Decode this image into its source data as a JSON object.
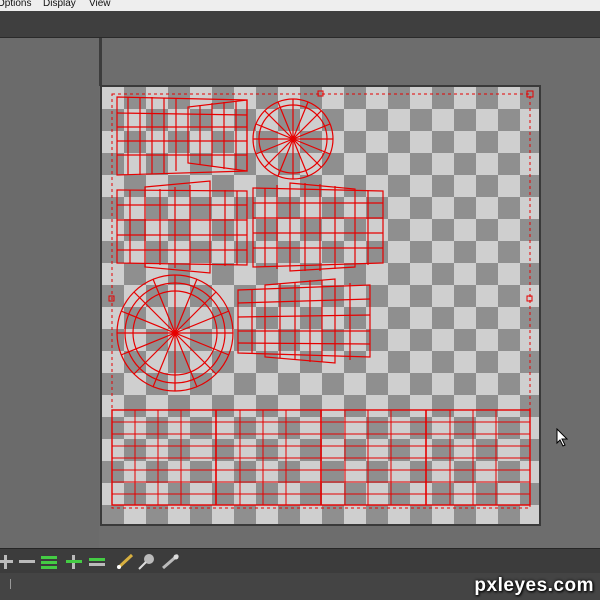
{
  "menu": {
    "items": [
      {
        "label": "Options"
      },
      {
        "label": "Display"
      },
      {
        "label": "View"
      }
    ]
  },
  "uv_editor": {
    "wire_color": "#e60000",
    "checker_light": "#cfcfcf",
    "checker_dark": "#8f8f8f",
    "shells": [
      "barrel-side-shell-1",
      "barrel-cap-shell-top",
      "barrel-side-shell-2",
      "barrel-side-shell-3",
      "barrel-cap-shell-bottom",
      "barrel-side-shell-4",
      "barrel-band-strip"
    ]
  },
  "toolbar": {
    "icons": [
      "add-icon",
      "minus-icon",
      "stack-icon",
      "add-icon",
      "minus-icon",
      "brush-icon",
      "pin-icon",
      "pencil-icon"
    ]
  },
  "watermark": {
    "text": "pxleyes.com"
  }
}
